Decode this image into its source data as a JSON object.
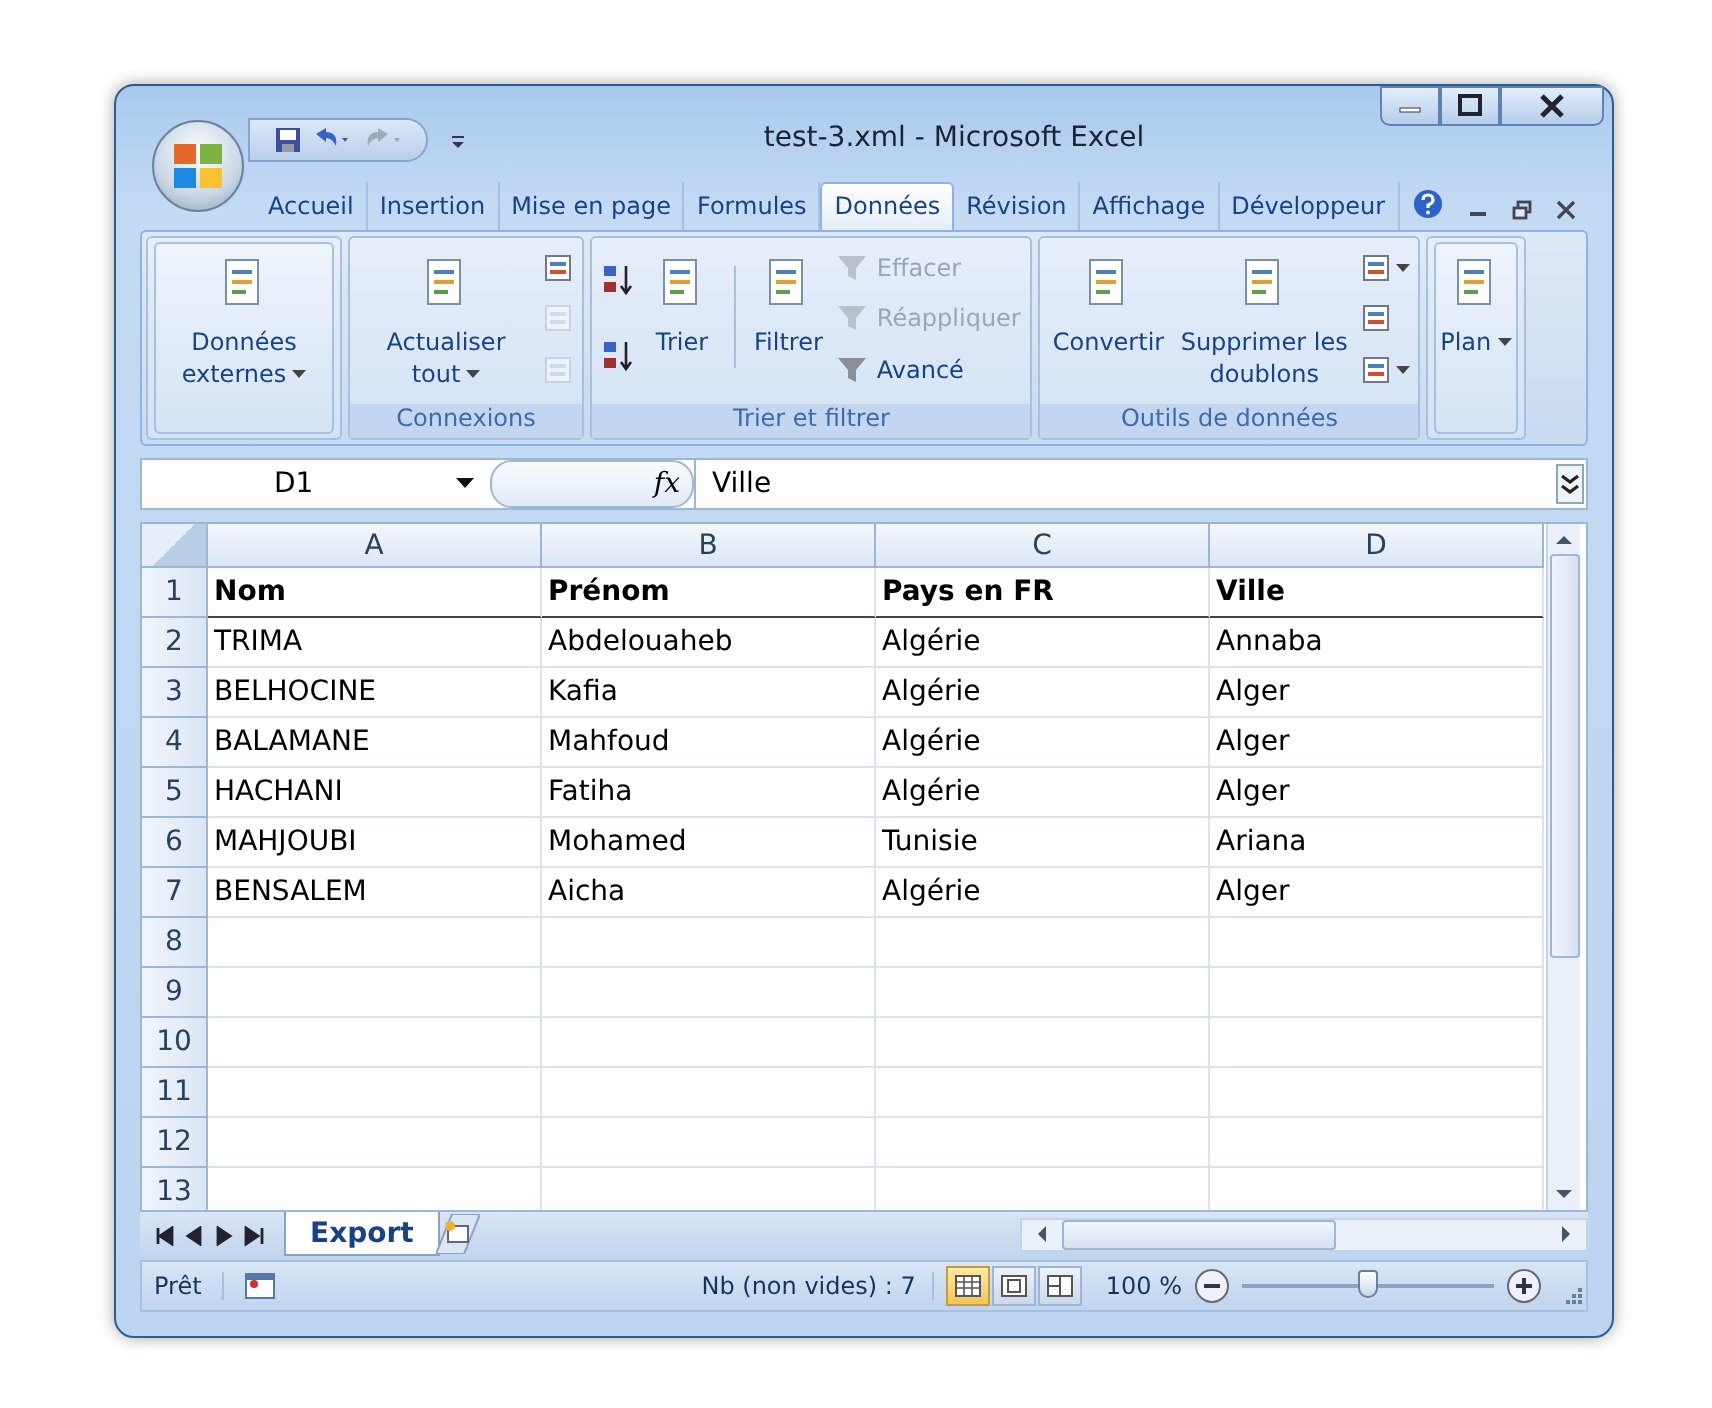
{
  "window": {
    "title": "test-3.xml - Microsoft Excel"
  },
  "tabs": [
    {
      "label": "Accueil",
      "selected": false
    },
    {
      "label": "Insertion",
      "selected": false
    },
    {
      "label": "Mise en page",
      "selected": false
    },
    {
      "label": "Formules",
      "selected": false
    },
    {
      "label": "Données",
      "selected": true
    },
    {
      "label": "Révision",
      "selected": false
    },
    {
      "label": "Affichage",
      "selected": false
    },
    {
      "label": "Développeur",
      "selected": false
    }
  ],
  "ribbon": [
    {
      "items": [
        {
          "kind": "large",
          "label": "Données externes",
          "caret": true,
          "disabled": false,
          "framed": true
        }
      ]
    },
    {
      "label": "Connexions",
      "items": [
        {
          "kind": "large",
          "label": "Actualiser tout",
          "caret": true,
          "disabled": false,
          "framed": false
        },
        {
          "kind": "column",
          "items": [
            {
              "kind": "icon",
              "disabled": false
            },
            {
              "kind": "icon",
              "disabled": true
            },
            {
              "kind": "icon",
              "disabled": true
            }
          ]
        }
      ]
    },
    {
      "label": "Trier et filtrer",
      "items": [
        {
          "kind": "column",
          "items": [
            {
              "kind": "sort",
              "disabled": false
            },
            {
              "kind": "sort",
              "disabled": false
            }
          ]
        },
        {
          "kind": "large",
          "label": "Trier",
          "caret": false,
          "disabled": false,
          "framed": false
        },
        {
          "kind": "separator"
        },
        {
          "kind": "large",
          "label": "Filtrer",
          "caret": false,
          "disabled": false,
          "framed": false
        },
        {
          "kind": "column",
          "items": [
            {
              "kind": "small",
              "label": "Effacer",
              "disabled": true
            },
            {
              "kind": "small",
              "label": "Réappliquer",
              "disabled": true
            },
            {
              "kind": "small",
              "label": "Avancé",
              "disabled": false
            }
          ]
        }
      ]
    },
    {
      "label": "Outils de données",
      "items": [
        {
          "kind": "large",
          "label": "Convertir",
          "caret": false,
          "disabled": false,
          "framed": false
        },
        {
          "kind": "large",
          "label": "Supprimer les doublons",
          "caret": false,
          "disabled": false,
          "framed": false
        },
        {
          "kind": "column",
          "items": [
            {
              "kind": "icon",
              "disabled": false,
              "caret": true
            },
            {
              "kind": "icon",
              "disabled": false,
              "caret": false
            },
            {
              "kind": "icon",
              "disabled": false,
              "caret": true
            }
          ]
        }
      ]
    },
    {
      "items": [
        {
          "kind": "large",
          "label": "Plan",
          "caret": true,
          "disabled": false,
          "framed": true
        }
      ]
    }
  ],
  "formula_bar": {
    "name_box": "D1",
    "fx": "fx",
    "value": "Ville"
  },
  "sheet": {
    "columns": [
      "A",
      "B",
      "C",
      "D"
    ],
    "rows": [
      {
        "number": "1",
        "bold": true,
        "cells": [
          "Nom",
          "Prénom",
          "Pays en FR",
          "Ville"
        ]
      },
      {
        "number": "2",
        "bold": false,
        "cells": [
          "TRIMA",
          "Abdelouaheb",
          "Algérie",
          "Annaba"
        ]
      },
      {
        "number": "3",
        "bold": false,
        "cells": [
          "BELHOCINE",
          "Kafia",
          "Algérie",
          "Alger"
        ]
      },
      {
        "number": "4",
        "bold": false,
        "cells": [
          "BALAMANE",
          "Mahfoud",
          "Algérie",
          "Alger"
        ]
      },
      {
        "number": "5",
        "bold": false,
        "cells": [
          "HACHANI",
          "Fatiha",
          "Algérie",
          "Alger"
        ]
      },
      {
        "number": "6",
        "bold": false,
        "cells": [
          "MAHJOUBI",
          "Mohamed",
          "Tunisie",
          "Ariana"
        ]
      },
      {
        "number": "7",
        "bold": false,
        "cells": [
          "BENSALEM",
          "Aicha",
          "Algérie",
          "Alger"
        ]
      },
      {
        "number": "8",
        "bold": false,
        "cells": []
      },
      {
        "number": "9",
        "bold": false,
        "cells": []
      },
      {
        "number": "10",
        "bold": false,
        "cells": []
      },
      {
        "number": "11",
        "bold": false,
        "cells": []
      },
      {
        "number": "12",
        "bold": false,
        "cells": []
      },
      {
        "number": "13",
        "bold": false,
        "cells": []
      }
    ]
  },
  "sheet_tabs": [
    {
      "label": "Export",
      "selected": true
    }
  ],
  "status_bar": {
    "ready": "Prêt",
    "count": "Nb (non vides) : 7",
    "views": [
      {
        "selected": true
      },
      {
        "selected": false
      },
      {
        "selected": false
      }
    ],
    "zoom": "100 %",
    "zoom_slider": {
      "level": 0.5
    }
  }
}
